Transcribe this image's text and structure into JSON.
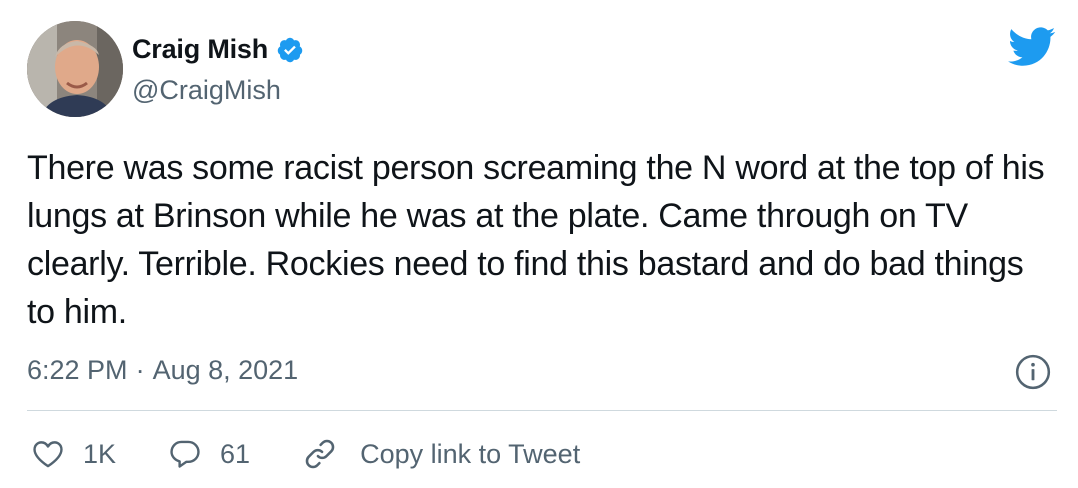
{
  "author": {
    "display_name": "Craig Mish",
    "handle": "@CraigMish",
    "verified": true
  },
  "tweet": {
    "text": "There was some racist person screaming the N word at the top of his lungs at Brinson while he was at the plate. Came through on TV clearly. Terrible. Rockies need to find this bastard and do bad things to him.",
    "time": "6:22 PM",
    "separator": "·",
    "date": "Aug 8, 2021"
  },
  "actions": {
    "likes": "1K",
    "replies": "61",
    "copy_link_label": "Copy link to Tweet"
  },
  "icons": {
    "brand": "twitter-bird-icon",
    "verified": "verified-badge-icon",
    "info": "info-icon",
    "like": "heart-icon",
    "reply": "reply-bubble-icon",
    "copy": "link-icon"
  },
  "colors": {
    "brand_blue": "#1d9bf0",
    "text_primary": "#0f1419",
    "text_secondary": "#536471",
    "divider": "#cfd9de"
  }
}
